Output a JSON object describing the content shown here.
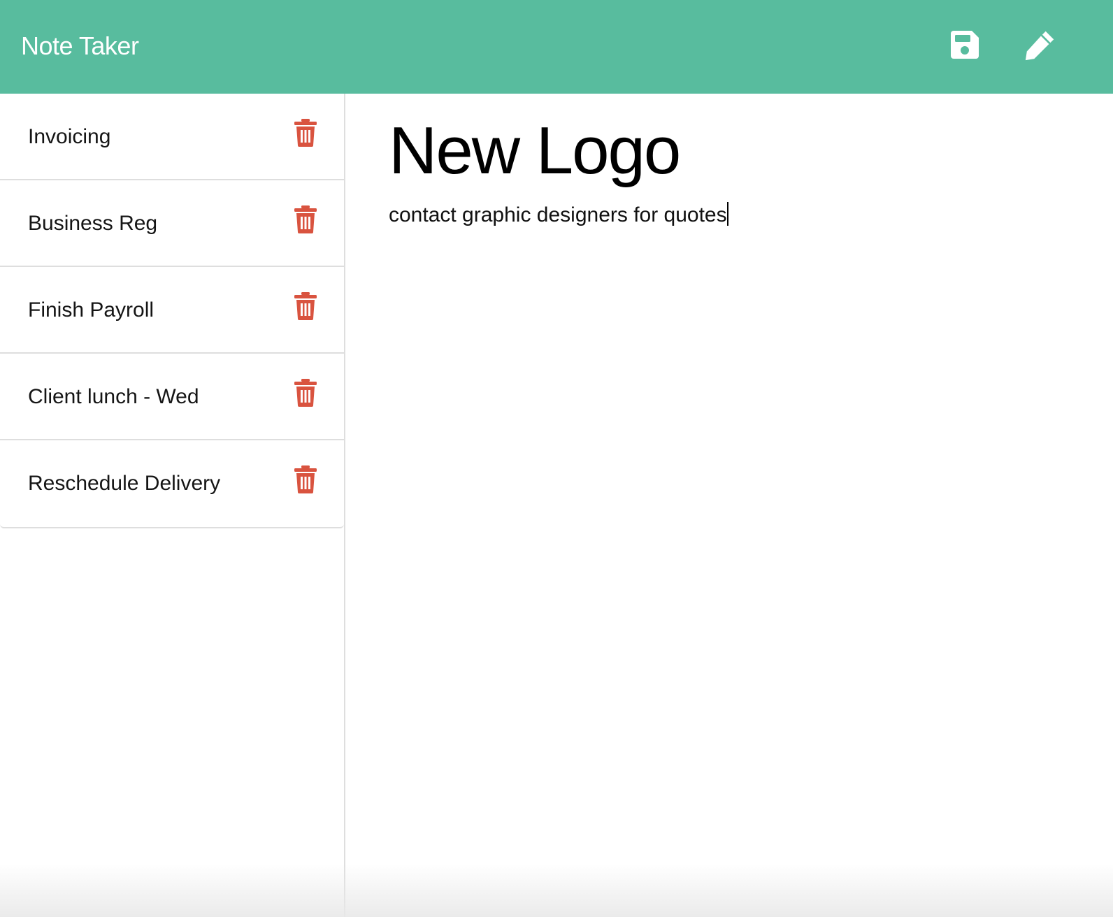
{
  "navbar": {
    "brand": "Note Taker",
    "save_icon": "save-floppy-icon",
    "edit_icon": "pencil-icon",
    "background_color": "#58bc9e"
  },
  "sidebar": {
    "notes": [
      {
        "title": "Invoicing",
        "delete_icon": "trash-icon"
      },
      {
        "title": "Business Reg",
        "delete_icon": "trash-icon"
      },
      {
        "title": "Finish Payroll",
        "delete_icon": "trash-icon"
      },
      {
        "title": "Client lunch - Wed",
        "delete_icon": "trash-icon"
      },
      {
        "title": "Reschedule Delivery",
        "delete_icon": "trash-icon"
      }
    ],
    "delete_icon_color": "#d9533f"
  },
  "editor": {
    "title": "New Logo",
    "body": "contact graphic designers for quotes"
  }
}
